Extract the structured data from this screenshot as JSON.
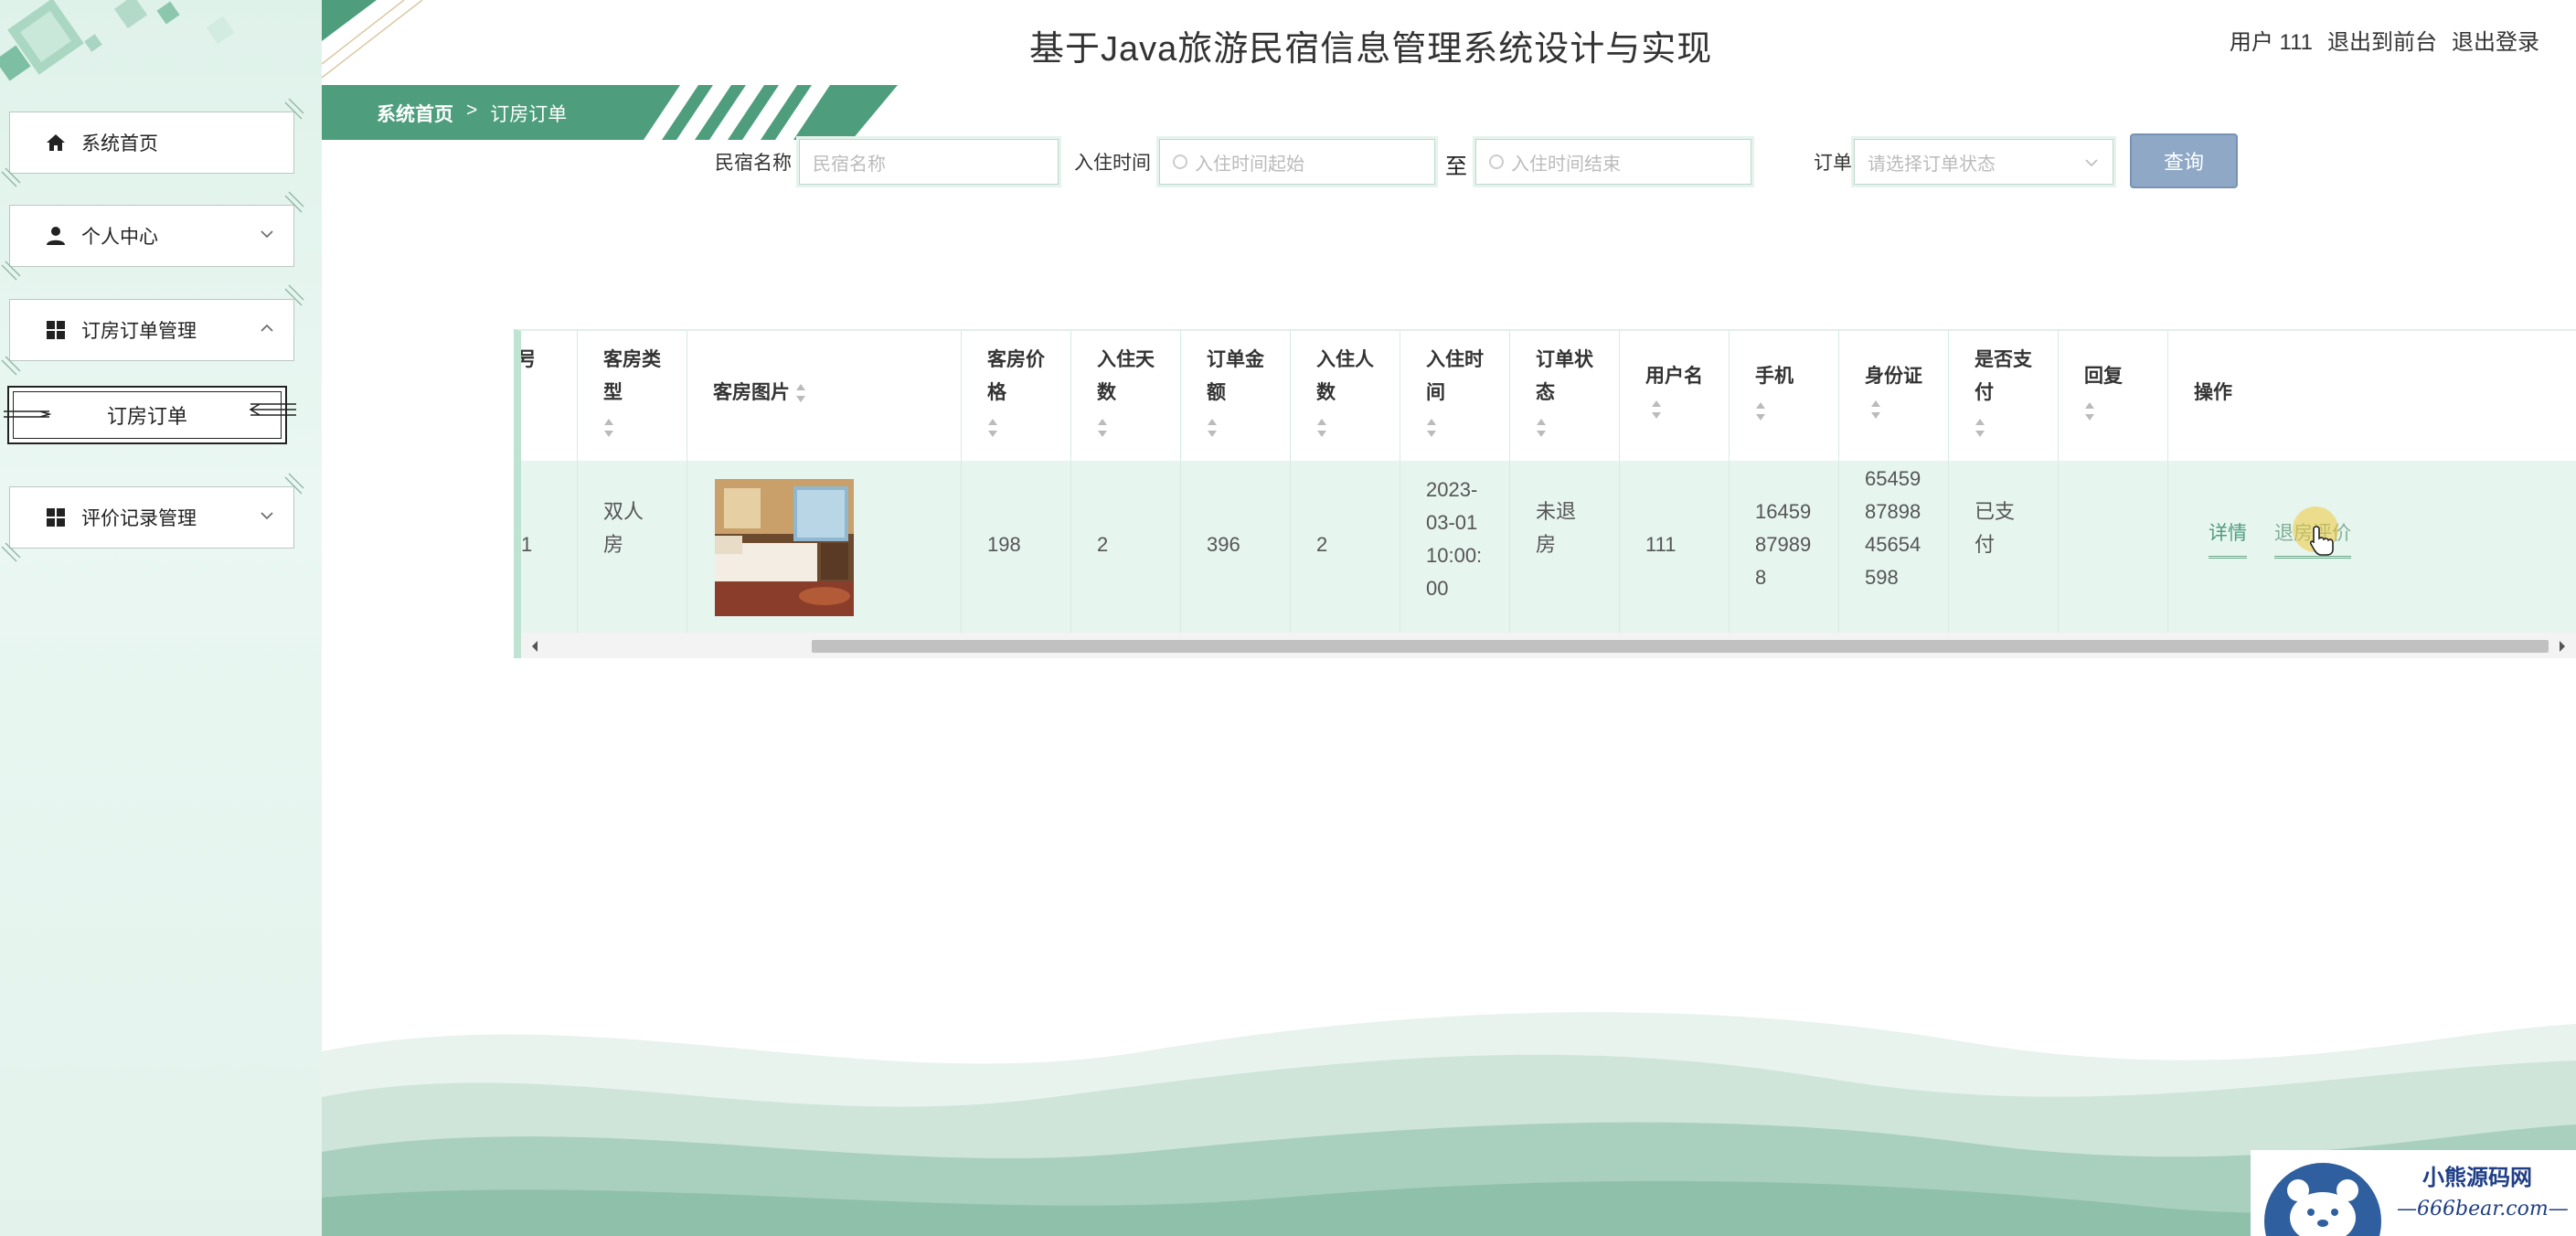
{
  "header": {
    "title": "基于Java旅游民宿信息管理系统设计与实现",
    "user_label": "用户 111",
    "back_to_front": "退出到前台",
    "logout": "退出登录"
  },
  "sidebar": {
    "items": [
      {
        "label": "系统首页",
        "icon": "home-icon"
      },
      {
        "label": "个人中心",
        "icon": "user-icon"
      },
      {
        "label": "订房订单管理",
        "icon": "grid-icon"
      },
      {
        "label": "评价记录管理",
        "icon": "grid-icon"
      }
    ],
    "sub_item": "订房订单"
  },
  "breadcrumb": {
    "home": "系统首页",
    "separator": ">",
    "current": "订房订单"
  },
  "search": {
    "homestay_label": "民宿名称",
    "homestay_placeholder": "民宿名称",
    "checkin_label": "入住时间",
    "start_placeholder": "入住时间起始",
    "to_label": "至",
    "end_placeholder": "入住时间结束",
    "status_label": "订单状态",
    "status_placeholder": "请选择订单状态",
    "query_button": "查询"
  },
  "table": {
    "headers": {
      "partial": "号",
      "room_type": "客房类型",
      "room_image": "客房图片",
      "room_price": "客房价格",
      "days": "入住天数",
      "amount": "订单金额",
      "people": "入住人数",
      "checkin_time": "入住时间",
      "status": "订单状态",
      "username": "用户名",
      "phone": "手机",
      "id_card": "身份证",
      "paid": "是否支付",
      "reply": "回复",
      "actions": "操作"
    },
    "row": {
      "partial": "1",
      "room_type": "双人房",
      "room_price": "198",
      "days": "2",
      "amount": "396",
      "people": "2",
      "checkin_time": "2023-03-01 10:00:00",
      "status": "未退房",
      "username": "111",
      "phone": "16459879898",
      "id_card": "654598789845654598",
      "paid": "已支付",
      "reply": ""
    },
    "actions": {
      "detail": "详情",
      "checkout_review": "退房评价"
    }
  },
  "badge": {
    "title": "小熊源码网",
    "url": "—666bear.com—"
  },
  "colors": {
    "accent": "#4e9e7d",
    "table_row": "#e7f5ef",
    "query_button": "#8ea8c6"
  }
}
